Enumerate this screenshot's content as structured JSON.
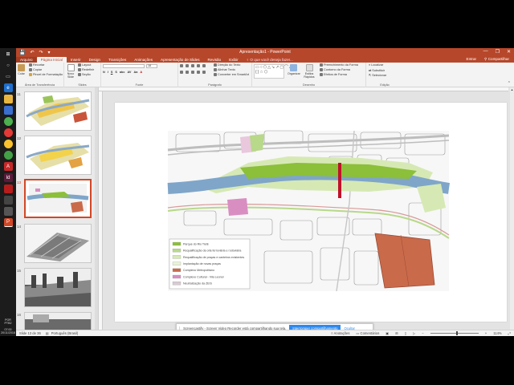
{
  "app": {
    "title": "Apresentação1 - PowerPoint",
    "quick_access": [
      "💾",
      "↶",
      "↷",
      "▾"
    ],
    "window_controls": [
      "—",
      "❐",
      "✕"
    ]
  },
  "tabs": {
    "file": "Arquivo",
    "items": [
      "Página Inicial",
      "Inserir",
      "Design",
      "Transições",
      "Animações",
      "Apresentação de Slides",
      "Revisão",
      "Exibir"
    ],
    "tell_me": "O que você deseja fazer...",
    "sign_in": "Entrar",
    "share": "Compartilhar"
  },
  "ribbon": {
    "clipboard": {
      "paste": "Colar",
      "cut": "Recortar",
      "copy": "Copiar",
      "format_painter": "Pincel de Formatação",
      "label": "Área de Transferência"
    },
    "slides": {
      "new_slide": "Novo Slide",
      "layout": "Layout",
      "reset": "Redefinir",
      "section": "Seção",
      "label": "Slides"
    },
    "font": {
      "label": "Fonte",
      "size": "18"
    },
    "paragraph": {
      "label": "Parágrafo",
      "text_direction": "Direção do Texto",
      "align_text": "Alinhar Texto",
      "smartart": "Converter em SmartArt"
    },
    "drawing": {
      "arrange": "Organizar",
      "quick_styles": "Estilos Rápidos",
      "fill": "Preenchimento da Forma",
      "outline": "Contorno da Forma",
      "effects": "Efeitos de Forma",
      "label": "Desenho"
    },
    "editing": {
      "find": "Localizar",
      "replace": "Substituir",
      "select": "Selecionar",
      "label": "Edição"
    }
  },
  "thumbnails": [
    {
      "num": "11"
    },
    {
      "num": "12"
    },
    {
      "num": "13",
      "selected": true
    },
    {
      "num": "14"
    },
    {
      "num": "15"
    },
    {
      "num": "16"
    }
  ],
  "legend": [
    {
      "color": "#8cbf3a",
      "label": "Parque do Rio Tietê"
    },
    {
      "color": "#b8d88a",
      "label": "Requalificação da orla ferroviária e rodoviária"
    },
    {
      "color": "#d6e9b4",
      "label": "Requalificação de praças e canteiros existentes"
    },
    {
      "color": "#e8f3d6",
      "label": "Implantação de novas praças"
    },
    {
      "color": "#c96a4b",
      "label": "Complexo Metropolitano"
    },
    {
      "color": "#d98ec2",
      "label": "Complexo Cultural - Vila Leonor"
    },
    {
      "color": "#d8cbd3",
      "label": "Neutralização da ZEIS"
    }
  ],
  "notification": {
    "text": "Screencastify - Screen Video Recorder está compartilhando sua tela.",
    "stop": "Interromper compartilhamento",
    "hide": "Ocultar"
  },
  "status": {
    "slide": "Slide 13 de 36",
    "language": "Português (Brasil)",
    "notes": "Anotações",
    "comments": "Comentários",
    "zoom": "114%"
  },
  "tray": {
    "lang": "POR",
    "layout": "PTB2",
    "time": "07:00",
    "date": "20/11/2018"
  },
  "colors": {
    "brand": "#b7472a",
    "river": "#7fa6c9",
    "park": "#8cbf3a",
    "complex": "#c96a4b",
    "cultural": "#d98ec2"
  }
}
